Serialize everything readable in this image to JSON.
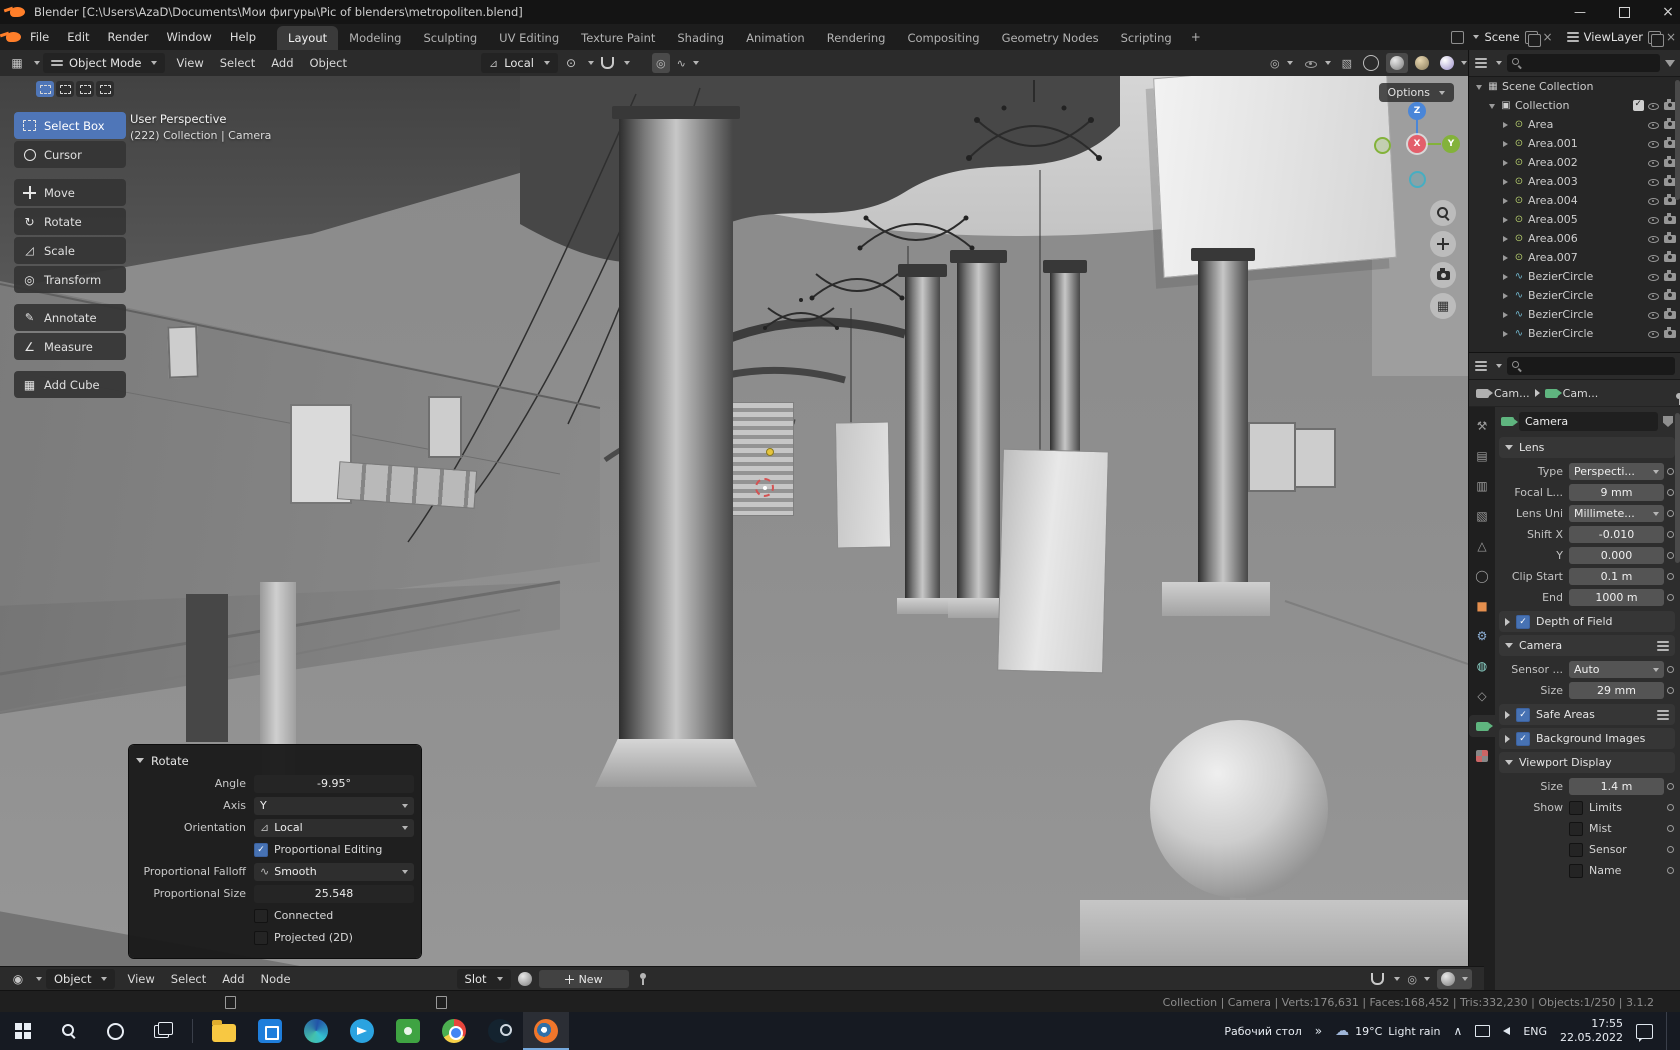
{
  "titlebar": {
    "title": "Blender [C:\\Users\\AzaD\\Documents\\Мои фигуры\\Pic of blenders\\metropoliten.blend]"
  },
  "topbar": {
    "menus": [
      "File",
      "Edit",
      "Render",
      "Window",
      "Help"
    ],
    "tabs": [
      {
        "label": "Layout",
        "active": true
      },
      {
        "label": "Modeling"
      },
      {
        "label": "Sculpting"
      },
      {
        "label": "UV Editing"
      },
      {
        "label": "Texture Paint"
      },
      {
        "label": "Shading"
      },
      {
        "label": "Animation"
      },
      {
        "label": "Rendering"
      },
      {
        "label": "Compositing"
      },
      {
        "label": "Geometry Nodes"
      },
      {
        "label": "Scripting"
      }
    ],
    "add_tab": "+",
    "scene_label": "Scene",
    "viewlayer_label": "ViewLayer"
  },
  "viewport_header": {
    "mode": "Object Mode",
    "menus": [
      "View",
      "Select",
      "Add",
      "Object"
    ],
    "orientation": "Local"
  },
  "toolbar": [
    {
      "label": "Select Box",
      "icon": "select-box-icon",
      "active": true
    },
    {
      "label": "Cursor",
      "icon": "cursor-tool-icon"
    },
    {
      "label": "Move",
      "icon": "move-icon",
      "gap": true
    },
    {
      "label": "Rotate",
      "icon": "rotate-icon"
    },
    {
      "label": "Scale",
      "icon": "scale-icon"
    },
    {
      "label": "Transform",
      "icon": "transform-icon"
    },
    {
      "label": "Annotate",
      "icon": "annotate-icon",
      "gap": true
    },
    {
      "label": "Measure",
      "icon": "measure-icon"
    },
    {
      "label": "Add Cube",
      "icon": "add-cube-icon",
      "gap": true
    }
  ],
  "viewport": {
    "view_label": "User Perspective",
    "context_label": "(222) Collection | Camera",
    "options_label": "Options",
    "axis_z": "Z",
    "axis_y": "Y",
    "axis_x": "X"
  },
  "rotate_panel": {
    "title": "Rotate",
    "angle_label": "Angle",
    "angle_value": "-9.95°",
    "axis_label": "Axis",
    "axis_value": "Y",
    "orientation_label": "Orientation",
    "orientation_value": "Local",
    "prop_edit_label": "Proportional Editing",
    "falloff_label": "Proportional Falloff",
    "falloff_value": "Smooth",
    "prop_size_label": "Proportional Size",
    "prop_size_value": "25.548",
    "connected_label": "Connected",
    "projected_label": "Projected (2D)"
  },
  "outliner": {
    "rows": [
      {
        "label": "Scene Collection",
        "icon": "scene-collection-icon",
        "depth": 0,
        "expanded": true
      },
      {
        "label": "Collection",
        "icon": "collection-icon",
        "depth": 1,
        "expanded": true,
        "checkbox": true,
        "controls": true
      },
      {
        "label": "Area",
        "icon": "area-light-icon",
        "depth": 2,
        "controls": true
      },
      {
        "label": "Area.001",
        "icon": "area-light-icon",
        "depth": 2,
        "controls": true
      },
      {
        "label": "Area.002",
        "icon": "area-light-icon",
        "depth": 2,
        "controls": true
      },
      {
        "label": "Area.003",
        "icon": "area-light-icon",
        "depth": 2,
        "controls": true
      },
      {
        "label": "Area.004",
        "icon": "area-light-icon",
        "depth": 2,
        "controls": true
      },
      {
        "label": "Area.005",
        "icon": "area-light-icon",
        "depth": 2,
        "controls": true
      },
      {
        "label": "Area.006",
        "icon": "area-light-icon",
        "depth": 2,
        "controls": true
      },
      {
        "label": "Area.007",
        "icon": "area-light-icon",
        "depth": 2,
        "controls": true
      },
      {
        "label": "BezierCircle",
        "icon": "curve-icon",
        "depth": 2,
        "controls": true
      },
      {
        "label": "BezierCircle",
        "icon": "curve-icon",
        "depth": 2,
        "controls": true
      },
      {
        "label": "BezierCircle",
        "icon": "curve-icon",
        "depth": 2,
        "controls": true
      },
      {
        "label": "BezierCircle",
        "icon": "curve-icon",
        "depth": 2,
        "controls": true
      }
    ]
  },
  "properties": {
    "breadcrumb_object": "Cam...",
    "breadcrumb_data": "Cam...",
    "name_value": "Camera",
    "lens_title": "Lens",
    "type_label": "Type",
    "type_value": "Perspecti...",
    "focal_label": "Focal L...",
    "focal_value": "9 mm",
    "unit_label": "Lens Uni",
    "unit_value": "Millimete...",
    "shiftx_label": "Shift X",
    "shiftx_value": "-0.010",
    "shifty_label": "Y",
    "shifty_value": "0.000",
    "clip_label": "Clip Start",
    "clip_value": "0.1 m",
    "end_label": "End",
    "end_value": "1000 m",
    "dof_title": "Depth of Field",
    "camera_title": "Camera",
    "sensor_label": "Sensor ...",
    "sensor_value": "Auto",
    "size_label": "Size",
    "size_value": "29 mm",
    "safe_title": "Safe Areas",
    "bg_title": "Background Images",
    "vd_title": "Viewport Display",
    "vd_size_label": "Size",
    "vd_size_value": "1.4 m",
    "show_label": "Show",
    "show_limits": "Limits",
    "show_mist": "Mist",
    "show_sensor": "Sensor",
    "show_name": "Name"
  },
  "node_editor": {
    "mode": "Object",
    "menus": [
      "View",
      "Select",
      "Add",
      "Node"
    ],
    "slot_label": "Slot",
    "new_label": "New"
  },
  "statusbar": {
    "stats": "Collection | Camera | Verts:176,631 | Faces:168,452 | Tris:332,230 | Objects:1/250 | 3.1.2"
  },
  "taskbar": {
    "desktop_toolbar": "Рабочий стол",
    "chevron": "»",
    "weather_temp": "19°C",
    "weather_desc": "Light rain",
    "lang": "ENG",
    "time": "17:55",
    "date": "22.05.2022"
  }
}
